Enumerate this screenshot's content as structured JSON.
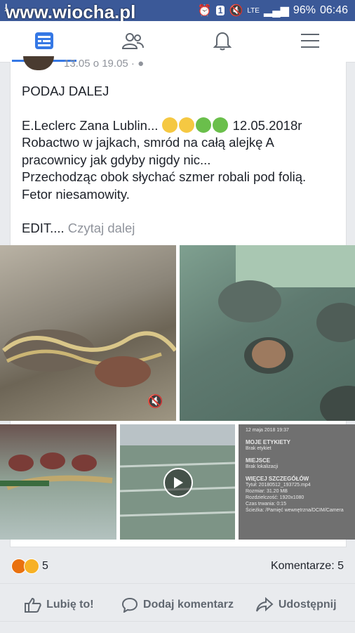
{
  "watermark": "www.wiocha.pl",
  "status": {
    "battery": "96%",
    "time": "06:46",
    "network": "LTE",
    "notif_badge": "1"
  },
  "tabs": [
    {
      "name": "news-feed",
      "icon": "news-feed-icon"
    },
    {
      "name": "friends",
      "icon": "friends-icon"
    },
    {
      "name": "notifications",
      "icon": "bell-icon"
    },
    {
      "name": "menu",
      "icon": "hamburger-menu-icon"
    }
  ],
  "post": {
    "meta": "13.05 o 19.05 · ",
    "line1": "PODAJ DALEJ",
    "line2_text": "E.Leclerc Zana Lublin...",
    "line2_date": " 12.05.2018r",
    "line3": "Robactwo w jajkach, smród na całą alejkę A pracownicy jak gdyby nigdy nic...",
    "line4": "Przechodząc obok słychać szmer robali pod folią. Fetor niesamowity.",
    "edit": "EDIT.... ",
    "read_more": "Czytaj dalej"
  },
  "photo5": {
    "date": "12 maja 2018 19:37",
    "h1": "MOJE ETYKIETY",
    "t1": "Brak etykiet",
    "h2": "MIEJSCE",
    "t2": "Brak lokalizacji",
    "h3": "WIĘCEJ SZCZEGÓŁÓW",
    "d1": "Tytuł: 20180512_193725.mp4",
    "d2": "Rozmiar: 31.20 MB",
    "d3": "Rozdzielczość: 1920x1080",
    "d4": "Czas trwania: 0:15",
    "d5": "Ścieżka: /Pamięć wewnętrzna/DCIM/Camera"
  },
  "reactions": {
    "count": "5",
    "comments": "Komentarze: 5"
  },
  "actions": {
    "like": "Lubię to!",
    "comment": "Dodaj komentarz",
    "share": "Udostępnij"
  },
  "colors": {
    "brand": "#3b5998",
    "active_tab": "#3578e5",
    "text": "#1d2129",
    "muted": "#90949c"
  }
}
